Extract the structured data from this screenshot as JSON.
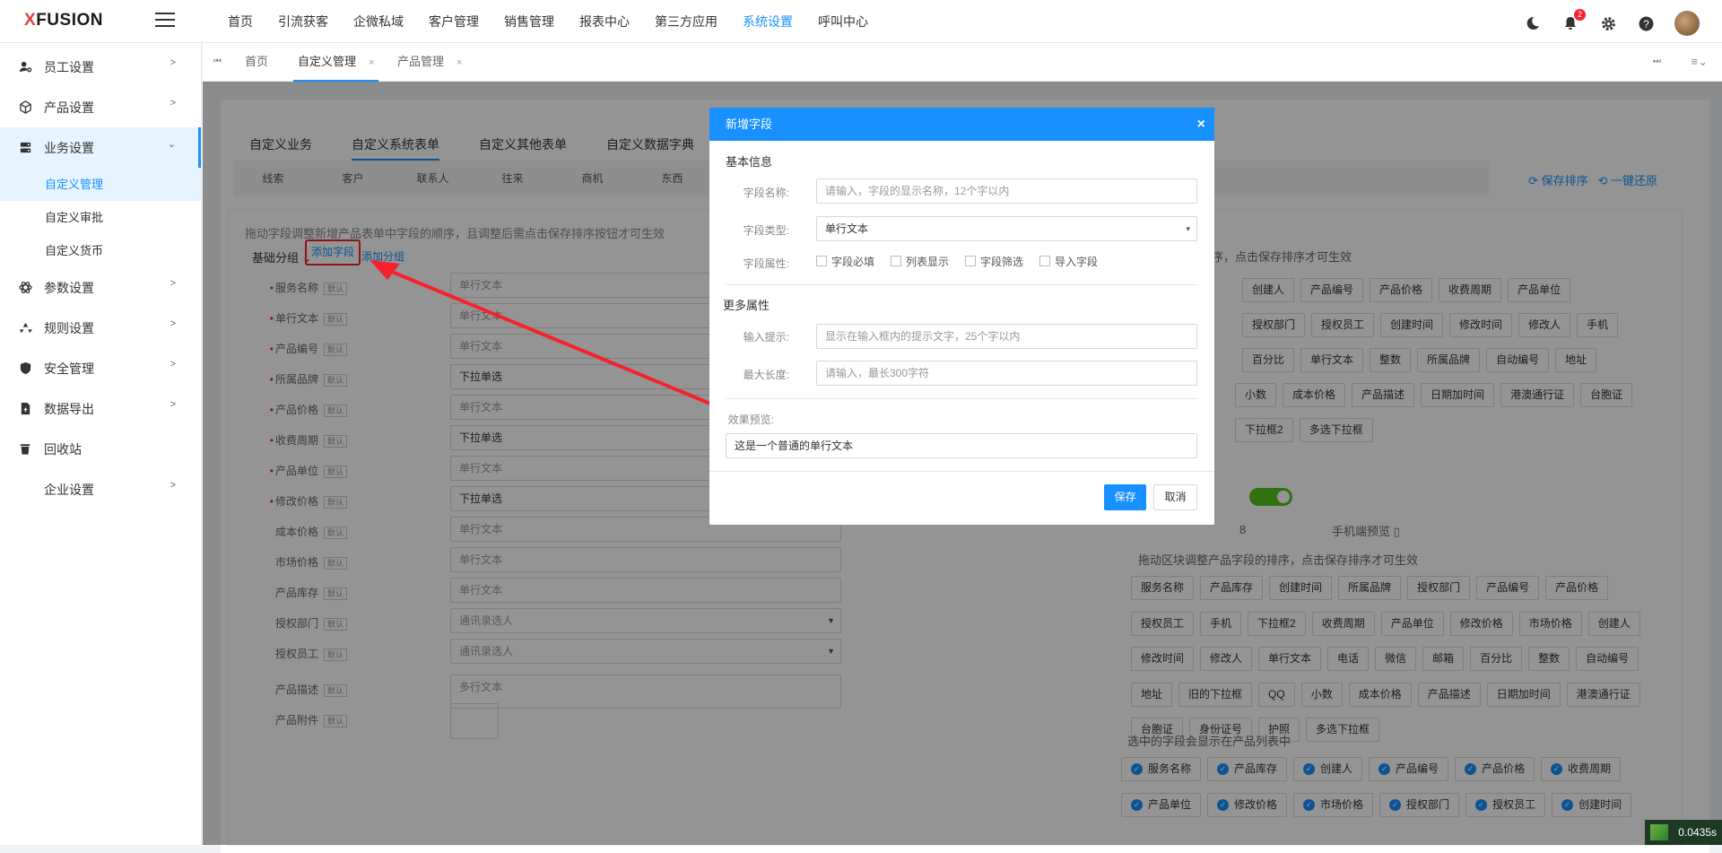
{
  "brand": {
    "logo_x": "X",
    "logo_rest": "FUSION"
  },
  "topnav": [
    "首页",
    "引流获客",
    "企微私域",
    "客户管理",
    "销售管理",
    "报表中心",
    "第三方应用",
    "系统设置",
    "呼叫中心"
  ],
  "topnav_active": "系统设置",
  "notify_count": "2",
  "sidebar": {
    "items": [
      {
        "label": "员工设置"
      },
      {
        "label": "产品设置"
      },
      {
        "label": "业务设置"
      },
      {
        "label": "参数设置"
      },
      {
        "label": "规则设置"
      },
      {
        "label": "安全管理"
      },
      {
        "label": "数据导出"
      },
      {
        "label": "回收站"
      },
      {
        "label": "企业设置"
      }
    ],
    "subitems": [
      "自定义管理",
      "自定义审批",
      "自定义货币"
    ]
  },
  "tabs": [
    {
      "label": "首页"
    },
    {
      "label": "自定义管理"
    },
    {
      "label": "产品管理"
    }
  ],
  "content": {
    "tabs": [
      "自定义业务",
      "自定义系统表单",
      "自定义其他表单",
      "自定义数据字典"
    ],
    "subtabs": [
      "线索",
      "客户",
      "联系人",
      "往来",
      "商机",
      "东西"
    ],
    "save_order": "保存排序",
    "restore": "一键还原",
    "hint": "拖动字段调整新增产品表单中字段的顺序，且调整后需点击保存排序按钮才可生效",
    "group_select": "基础分组",
    "add_field": "添加字段",
    "add_group": "添加分组",
    "default_tag": "默认",
    "fields": [
      {
        "label": "服务名称",
        "value": "单行文本",
        "required": true,
        "dark": false,
        "dropdown": false
      },
      {
        "label": "单行文本",
        "value": "单行文本",
        "required": true,
        "dark": false,
        "dropdown": false
      },
      {
        "label": "产品编号",
        "value": "单行文本",
        "required": true,
        "dark": false,
        "dropdown": false
      },
      {
        "label": "所属品牌",
        "value": "下拉单选",
        "required": true,
        "dark": true,
        "dropdown": false
      },
      {
        "label": "产品价格",
        "value": "单行文本",
        "required": true,
        "dark": false,
        "dropdown": false
      },
      {
        "label": "收费周期",
        "value": "下拉单选",
        "required": true,
        "dark": true,
        "dropdown": false
      },
      {
        "label": "产品单位",
        "value": "单行文本",
        "required": true,
        "dark": false,
        "dropdown": false
      },
      {
        "label": "修改价格",
        "value": "下拉单选",
        "required": true,
        "dark": true,
        "dropdown": true
      },
      {
        "label": "成本价格",
        "value": "单行文本",
        "required": false,
        "dark": false,
        "dropdown": false
      },
      {
        "label": "市场价格",
        "value": "单行文本",
        "required": false,
        "dark": false,
        "dropdown": false
      },
      {
        "label": "产品库存",
        "value": "单行文本",
        "required": false,
        "dark": false,
        "dropdown": false
      },
      {
        "label": "授权部门",
        "value": "通讯录选人",
        "required": false,
        "dark": false,
        "dropdown": true
      },
      {
        "label": "授权员工",
        "value": "通讯录选人",
        "required": false,
        "dark": false,
        "dropdown": true
      },
      {
        "label": "产品描述",
        "value": "多行文本",
        "required": false,
        "dark": false,
        "dropdown": false
      },
      {
        "label": "产品附件",
        "value": "",
        "required": false,
        "dark": false,
        "dropdown": false
      }
    ],
    "right_hint1": "的排序，点击保存排序才可生效",
    "right_tags_top": [
      [
        "创建人",
        "产品编号",
        "产品价格",
        "收费周期",
        "产品单位"
      ],
      [
        "授权部门",
        "授权员工",
        "创建时间",
        "修改时间",
        "修改人",
        "手机"
      ],
      [
        "百分比",
        "单行文本",
        "整数",
        "所属品牌",
        "自动编号",
        "地址"
      ],
      [
        "小数",
        "成本价格",
        "产品描述",
        "日期加时间",
        "港澳通行证",
        "台胞证"
      ],
      [
        "下拉框2",
        "多选下拉框"
      ]
    ],
    "mobile_preview": "手机端预览",
    "number_frag": "8",
    "right_hint2": "拖动区块调整产品字段的排序，点击保存排序才可生效",
    "right_tags_mid": [
      [
        "服务名称",
        "产品库存",
        "创建时间",
        "所属品牌",
        "授权部门",
        "产品编号",
        "产品价格"
      ],
      [
        "授权员工",
        "手机",
        "下拉框2",
        "收费周期",
        "产品单位",
        "修改价格",
        "市场价格",
        "创建人"
      ],
      [
        "修改时间",
        "修改人",
        "单行文本",
        "电话",
        "微信",
        "邮箱",
        "百分比",
        "整数",
        "自动编号"
      ],
      [
        "地址",
        "旧的下拉框",
        "QQ",
        "小数",
        "成本价格",
        "产品描述",
        "日期加时间",
        "港澳通行证"
      ],
      [
        "台胞证",
        "身份证号",
        "护照",
        "多选下拉框"
      ]
    ],
    "right_hint3": "选中的字段会显示在产品列表中",
    "right_tags_checked": [
      [
        "服务名称",
        "产品库存",
        "创建人",
        "产品编号",
        "产品价格",
        "收费周期"
      ],
      [
        "产品单位",
        "修改价格",
        "市场价格",
        "授权部门",
        "授权员工",
        "创建时间"
      ]
    ]
  },
  "modal": {
    "title": "新增字段",
    "section_basic": "基本信息",
    "name_label": "字段名称:",
    "name_placeholder": "请输入，字段的显示名称，12个字以内",
    "type_label": "字段类型:",
    "type_value": "单行文本",
    "attr_label": "字段属性:",
    "attrs": [
      "字段必填",
      "列表显示",
      "字段筛选",
      "导入字段"
    ],
    "section_more": "更多属性",
    "tip_label": "输入提示:",
    "tip_placeholder": "显示在输入框内的提示文字，25个字以内",
    "maxlen_label": "最大长度:",
    "maxlen_placeholder": "请输入，最长300字符",
    "preview_label": "效果预览:",
    "preview_value": "这是一个普通的单行文本",
    "save": "保存",
    "cancel": "取消"
  },
  "timer": "0.0435s",
  "colors": {
    "accent": "#1890ff",
    "danger": "#f5222d",
    "switch": "#52c41a"
  }
}
